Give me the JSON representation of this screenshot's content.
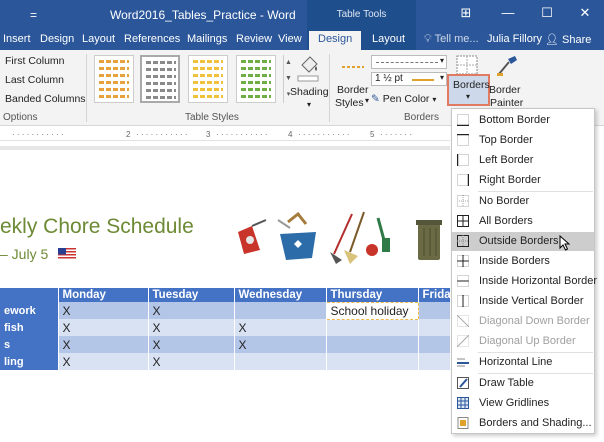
{
  "titlebar": {
    "doc_title": "Word2016_Tables_Practice - Word",
    "context_group": "Table Tools",
    "qat_glyph": "="
  },
  "tabs": [
    {
      "label": "Insert"
    },
    {
      "label": "Design"
    },
    {
      "label": "Layout"
    },
    {
      "label": "References"
    },
    {
      "label": "Mailings"
    },
    {
      "label": "Review"
    },
    {
      "label": "View"
    },
    {
      "label": "Design"
    },
    {
      "label": "Layout"
    }
  ],
  "tell_me": "Tell me...",
  "user": "Julia Fillory",
  "share": "Share",
  "ribbon": {
    "options": [
      "First Column",
      "Last Column",
      "Banded Columns"
    ],
    "options_group": "Options",
    "table_styles_group": "Table Styles",
    "shading": "Shading",
    "border_styles_1": "Border",
    "border_styles_2": "Styles",
    "line_weight": "1 ½ pt",
    "pen_color": "Pen Color",
    "borders": "Borders",
    "border_painter_1": "Border",
    "border_painter_2": "Painter",
    "borders_group": "Borders"
  },
  "ruler_marks": [
    "2",
    "3",
    "4",
    "5"
  ],
  "doc": {
    "title": "ekly Chore Schedule",
    "date": "– July 5"
  },
  "table": {
    "headers": [
      "",
      "Monday",
      "Tuesday",
      "Wednesday",
      "Thursday",
      "Frida"
    ],
    "rows": [
      {
        "label": "ework",
        "cells": [
          "X",
          "X",
          "",
          "School holiday",
          ""
        ]
      },
      {
        "label": "fish",
        "cells": [
          "X",
          "X",
          "X",
          "",
          ""
        ]
      },
      {
        "label": "s",
        "cells": [
          "X",
          "X",
          "X",
          "",
          ""
        ]
      },
      {
        "label": "ling",
        "cells": [
          "X",
          "X",
          "",
          "",
          ""
        ]
      }
    ]
  },
  "menu": {
    "items": [
      {
        "label": "Bottom Border",
        "icon": "bottom-border-icon"
      },
      {
        "label": "Top Border",
        "icon": "top-border-icon"
      },
      {
        "label": "Left Border",
        "icon": "left-border-icon"
      },
      {
        "label": "Right Border",
        "icon": "right-border-icon"
      },
      {
        "label": "No Border",
        "icon": "no-border-icon"
      },
      {
        "label": "All Borders",
        "icon": "all-borders-icon"
      },
      {
        "label": "Outside Borders",
        "icon": "outside-borders-icon"
      },
      {
        "label": "Inside Borders",
        "icon": "inside-borders-icon"
      },
      {
        "label": "Inside Horizontal Border",
        "icon": "inside-horizontal-border-icon"
      },
      {
        "label": "Inside Vertical Border",
        "icon": "inside-vertical-border-icon"
      },
      {
        "label": "Diagonal Down Border",
        "icon": "diagonal-down-border-icon"
      },
      {
        "label": "Diagonal Up Border",
        "icon": "diagonal-up-border-icon"
      },
      {
        "label": "Horizontal Line",
        "icon": "horizontal-line-icon"
      },
      {
        "label": "Draw Table",
        "icon": "draw-table-icon"
      },
      {
        "label": "View Gridlines",
        "icon": "view-gridlines-icon"
      },
      {
        "label": "Borders and Shading...",
        "icon": "borders-and-shading-icon"
      }
    ]
  },
  "colors": {
    "title_bar": "#2b579a",
    "table_header": "#4472c4",
    "band_dark": "#b4c6e7",
    "band_light": "#d9e2f3",
    "title_green": "#6d8a35",
    "highlight": "#e07a60"
  }
}
